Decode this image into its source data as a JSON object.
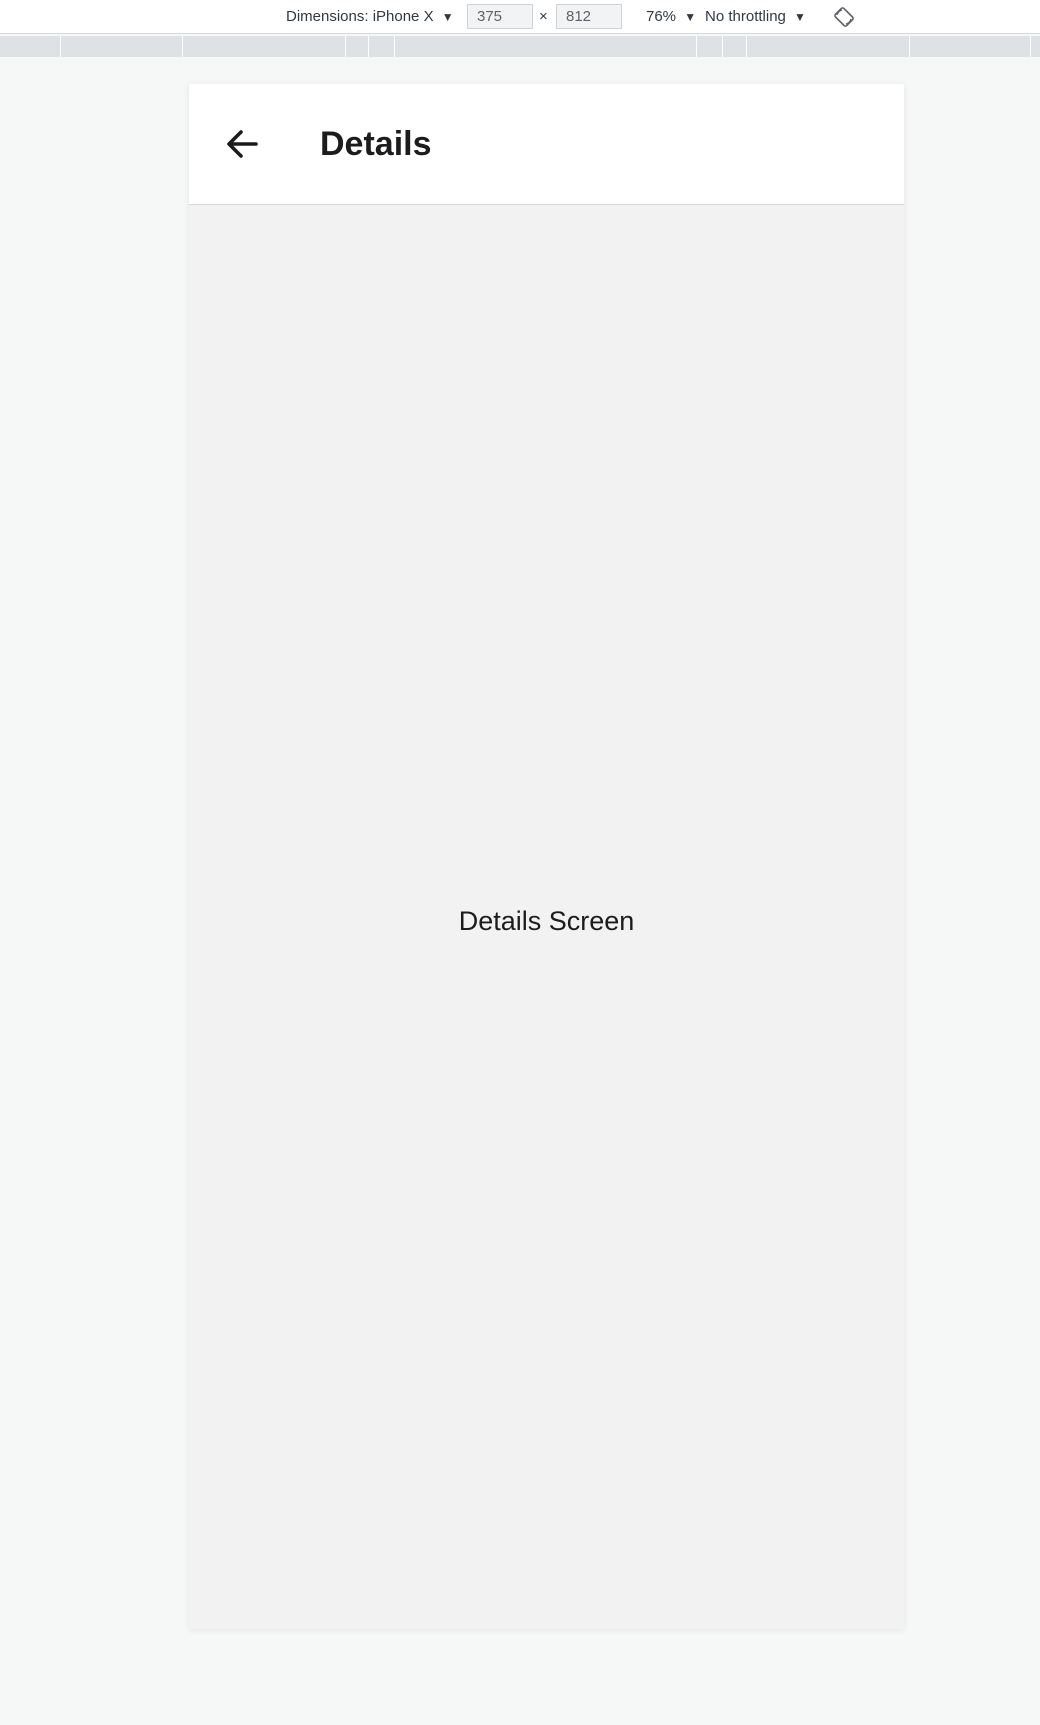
{
  "devtools": {
    "dimensions_label": "Dimensions: iPhone X",
    "width_value": "375",
    "height_value": "812",
    "times_symbol": "×",
    "zoom_label": "76%",
    "throttle_label": "No throttling",
    "caret": "▼",
    "rotate_icon": "rotate-icon"
  },
  "app": {
    "header": {
      "title": "Details",
      "back_icon": "arrow-left-icon"
    },
    "body": {
      "text": "Details Screen"
    }
  },
  "colors": {
    "header_bg": "#ffffff",
    "screen_bg": "#f2f2f2",
    "text": "#1c1c1e"
  }
}
